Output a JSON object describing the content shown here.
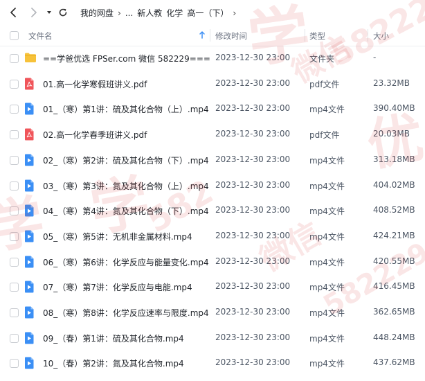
{
  "toolbar": {
    "back_icon": "chevron-left-icon",
    "forward_icon": "chevron-right-icon",
    "dropdown_icon": "caret-down-icon",
    "refresh_icon": "refresh-icon",
    "breadcrumbs": [
      "我的网盘",
      "...",
      "新人教",
      "化学",
      "高一（下）"
    ]
  },
  "header": {
    "name": "文件名",
    "modified": "修改时间",
    "type": "类型",
    "size": "大小",
    "sort_icon": "arrow-up-icon"
  },
  "files": [
    {
      "name": "==学爸优选 FPSer.com 微信 582229===",
      "time": "2023-12-30 23:00",
      "type": "文件夹",
      "size": "-",
      "icon": "folder"
    },
    {
      "name": "01.高一化学寒假班讲义.pdf",
      "time": "2023-12-30 23:00",
      "type": "pdf文件",
      "size": "23.32MB",
      "icon": "pdf"
    },
    {
      "name": "01_（寒）第1讲：硫及其化合物（上）.mp4",
      "time": "2023-12-30 23:00",
      "type": "mp4文件",
      "size": "390.40MB",
      "icon": "video"
    },
    {
      "name": "02.高一化学春季班讲义.pdf",
      "time": "2023-12-30 23:00",
      "type": "pdf文件",
      "size": "20.03MB",
      "icon": "pdf"
    },
    {
      "name": "02_（寒）第2讲：硫及其化合物（下）.mp4",
      "time": "2023-12-30 23:00",
      "type": "mp4文件",
      "size": "313.18MB",
      "icon": "video"
    },
    {
      "name": "03_（寒）第3讲：氮及其化合物（上）.mp4",
      "time": "2023-12-30 23:00",
      "type": "mp4文件",
      "size": "404.02MB",
      "icon": "video"
    },
    {
      "name": "04_（寒）第4讲：氮及其化合物（下）.mp4",
      "time": "2023-12-30 23:00",
      "type": "mp4文件",
      "size": "408.52MB",
      "icon": "video"
    },
    {
      "name": "05_（寒）第5讲：无机非金属材料.mp4",
      "time": "2023-12-30 23:00",
      "type": "mp4文件",
      "size": "424.21MB",
      "icon": "video"
    },
    {
      "name": "06_（寒）第6讲：化学反应与能量变化.mp4",
      "time": "2023-12-30 23:00",
      "type": "mp4文件",
      "size": "420.55MB",
      "icon": "video"
    },
    {
      "name": "07_（寒）第7讲：化学反应与电能.mp4",
      "time": "2023-12-30 23:00",
      "type": "mp4文件",
      "size": "416.45MB",
      "icon": "video"
    },
    {
      "name": "08_（寒）第8讲：化学反应速率与限度.mp4",
      "time": "2023-12-30 23:00",
      "type": "mp4文件",
      "size": "362.65MB",
      "icon": "video"
    },
    {
      "name": "09_（春）第1讲：硫及其化合物.mp4",
      "time": "2023-12-30 23:00",
      "type": "mp4文件",
      "size": "448.24MB",
      "icon": "video"
    },
    {
      "name": "10_（春）第2讲：氮及其化合物.mp4",
      "time": "2023-12-30 23:00",
      "type": "mp4文件",
      "size": "437.62MB",
      "icon": "video"
    }
  ],
  "colors": {
    "folder": "#f7c23a",
    "pdf": "#f0555a",
    "video": "#3b8ff5",
    "watermark": "#dc3c3c"
  },
  "watermark": {
    "texts": [
      "学",
      "微信",
      "582229",
      "优",
      "学",
      "582",
      "微信",
      "学",
      "582229"
    ]
  }
}
